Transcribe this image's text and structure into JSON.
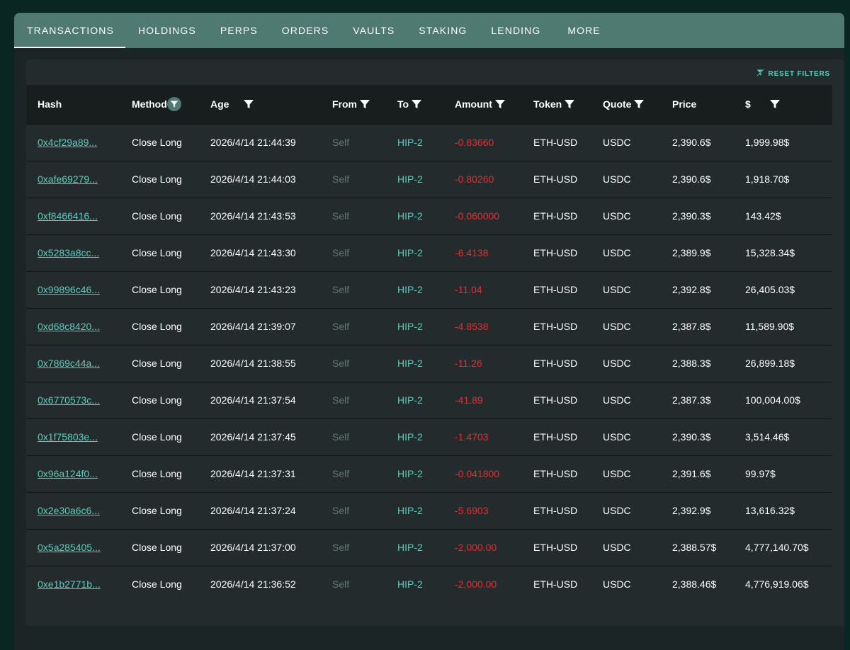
{
  "tabs": [
    {
      "label": "TRANSACTIONS",
      "active": true
    },
    {
      "label": "HOLDINGS"
    },
    {
      "label": "PERPS"
    },
    {
      "label": "ORDERS"
    },
    {
      "label": "VAULTS"
    },
    {
      "label": "STAKING"
    },
    {
      "label": "LENDING"
    },
    {
      "label": "MORE"
    }
  ],
  "reset_filters": "RESET FILTERS",
  "columns": {
    "hash": "Hash",
    "method": "Method",
    "age": "Age",
    "from": "From",
    "to": "To",
    "amount": "Amount",
    "token": "Token",
    "quote": "Quote",
    "price": "Price",
    "usd": "$"
  },
  "rows": [
    {
      "hash": "0x4cf29a89...",
      "method": "Close Long",
      "age": "2026/4/14 21:44:39",
      "from": "Self",
      "to": "HIP-2",
      "amount": "-0.83660",
      "token": "ETH-USD",
      "quote": "USDC",
      "price": "2,390.6$",
      "usd": "1,999.98$"
    },
    {
      "hash": "0xafe69279...",
      "method": "Close Long",
      "age": "2026/4/14 21:44:03",
      "from": "Self",
      "to": "HIP-2",
      "amount": "-0.80260",
      "token": "ETH-USD",
      "quote": "USDC",
      "price": "2,390.6$",
      "usd": "1,918.70$"
    },
    {
      "hash": "0xf8466416...",
      "method": "Close Long",
      "age": "2026/4/14 21:43:53",
      "from": "Self",
      "to": "HIP-2",
      "amount": "-0.060000",
      "token": "ETH-USD",
      "quote": "USDC",
      "price": "2,390.3$",
      "usd": "143.42$"
    },
    {
      "hash": "0x5283a8cc...",
      "method": "Close Long",
      "age": "2026/4/14 21:43:30",
      "from": "Self",
      "to": "HIP-2",
      "amount": "-6.4138",
      "token": "ETH-USD",
      "quote": "USDC",
      "price": "2,389.9$",
      "usd": "15,328.34$"
    },
    {
      "hash": "0x99896c46...",
      "method": "Close Long",
      "age": "2026/4/14 21:43:23",
      "from": "Self",
      "to": "HIP-2",
      "amount": "-11.04",
      "token": "ETH-USD",
      "quote": "USDC",
      "price": "2,392.8$",
      "usd": "26,405.03$"
    },
    {
      "hash": "0xd68c8420...",
      "method": "Close Long",
      "age": "2026/4/14 21:39:07",
      "from": "Self",
      "to": "HIP-2",
      "amount": "-4.8538",
      "token": "ETH-USD",
      "quote": "USDC",
      "price": "2,387.8$",
      "usd": "11,589.90$"
    },
    {
      "hash": "0x7869c44a...",
      "method": "Close Long",
      "age": "2026/4/14 21:38:55",
      "from": "Self",
      "to": "HIP-2",
      "amount": "-11.26",
      "token": "ETH-USD",
      "quote": "USDC",
      "price": "2,388.3$",
      "usd": "26,899.18$"
    },
    {
      "hash": "0x6770573c...",
      "method": "Close Long",
      "age": "2026/4/14 21:37:54",
      "from": "Self",
      "to": "HIP-2",
      "amount": "-41.89",
      "token": "ETH-USD",
      "quote": "USDC",
      "price": "2,387.3$",
      "usd": "100,004.00$"
    },
    {
      "hash": "0x1f75803e...",
      "method": "Close Long",
      "age": "2026/4/14 21:37:45",
      "from": "Self",
      "to": "HIP-2",
      "amount": "-1.4703",
      "token": "ETH-USD",
      "quote": "USDC",
      "price": "2,390.3$",
      "usd": "3,514.46$"
    },
    {
      "hash": "0x96a124f0...",
      "method": "Close Long",
      "age": "2026/4/14 21:37:31",
      "from": "Self",
      "to": "HIP-2",
      "amount": "-0.041800",
      "token": "ETH-USD",
      "quote": "USDC",
      "price": "2,391.6$",
      "usd": "99.97$"
    },
    {
      "hash": "0x2e30a6c6...",
      "method": "Close Long",
      "age": "2026/4/14 21:37:24",
      "from": "Self",
      "to": "HIP-2",
      "amount": "-5.6903",
      "token": "ETH-USD",
      "quote": "USDC",
      "price": "2,392.9$",
      "usd": "13,616.32$"
    },
    {
      "hash": "0x5a285405...",
      "method": "Close Long",
      "age": "2026/4/14 21:37:00",
      "from": "Self",
      "to": "HIP-2",
      "amount": "-2,000.00",
      "token": "ETH-USD",
      "quote": "USDC",
      "price": "2,388.57$",
      "usd": "4,777,140.70$"
    },
    {
      "hash": "0xe1b2771b...",
      "method": "Close Long",
      "age": "2026/4/14 21:36:52",
      "from": "Self",
      "to": "HIP-2",
      "amount": "-2,000.00",
      "token": "ETH-USD",
      "quote": "USDC",
      "price": "2,388.46$",
      "usd": "4,776,919.06$"
    }
  ],
  "colors": {
    "accent": "#51d2c1",
    "tab_bar": "#4e7a72",
    "negative": "#ed2a2a",
    "muted": "#5e7874"
  },
  "icons": {
    "filter": "filter-icon",
    "filter_active": "active-filter-icon",
    "reset": "filter-off-icon"
  }
}
